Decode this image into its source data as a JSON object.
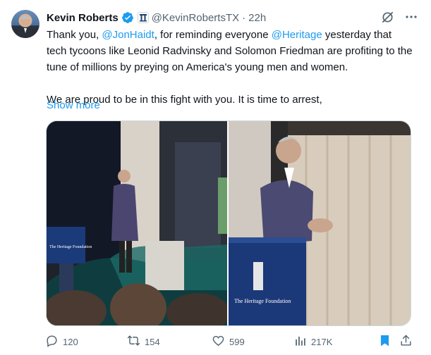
{
  "author": {
    "name": "Kevin Roberts",
    "handle": "@KevinRobertsTX",
    "separator": "·",
    "time": "22h"
  },
  "tweet": {
    "line1_pre": "Thank you, ",
    "mention1": "@JonHaidt",
    "line1_mid": ", for reminding everyone ",
    "mention2": "@Heritage",
    "line1_post": " yesterday that tech tycoons like Leonid Radvinsky and Solomon Friedman are profiting to the tune of millions by preying on America's young men and women.",
    "paragraph2": "We are proud to be in this fight with you. It is time to arrest,",
    "show_more": "Show more"
  },
  "media": {
    "podium_text_1": "The Heritage Foundation",
    "podium_text_2": "The Heritage Foundation"
  },
  "stats": {
    "replies": "120",
    "reposts": "154",
    "likes": "599",
    "views": "217K"
  },
  "colors": {
    "link": "#1d9bf0",
    "muted": "#536471",
    "verified": "#1d9bf0"
  }
}
